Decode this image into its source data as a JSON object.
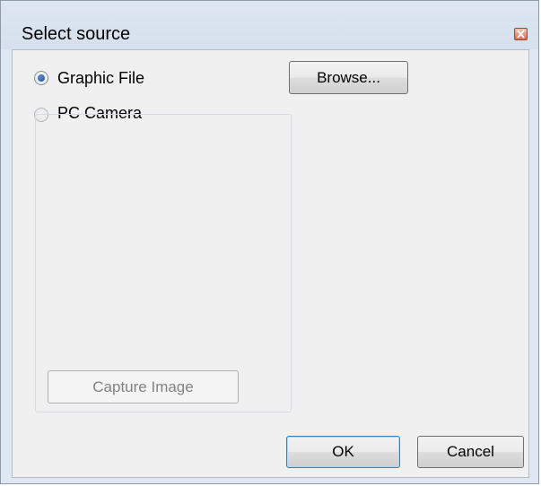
{
  "window": {
    "title": "Select source"
  },
  "source_options": [
    {
      "label": "Graphic File",
      "selected": true,
      "enabled": true
    },
    {
      "label": "PC Camera",
      "selected": false,
      "enabled": true
    }
  ],
  "buttons": {
    "browse": "Browse...",
    "capture_image": "Capture Image",
    "ok": "OK",
    "cancel": "Cancel"
  },
  "icons": {
    "close": "close-icon"
  }
}
